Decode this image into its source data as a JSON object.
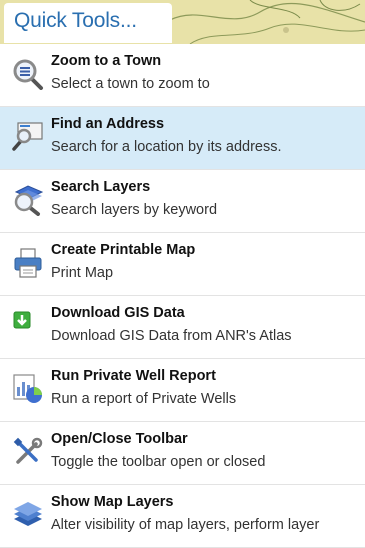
{
  "panel": {
    "title": "Quick Tools..."
  },
  "items": [
    {
      "name": "Zoom to a Town",
      "desc": "Select a town to zoom to",
      "icon": "magnifier-list-icon"
    },
    {
      "name": "Find an Address",
      "desc": "Search for a location by its address.",
      "icon": "find-address-icon"
    },
    {
      "name": "Search Layers",
      "desc": "Search layers by keyword",
      "icon": "search-layers-icon"
    },
    {
      "name": "Create Printable Map",
      "desc": "Print Map",
      "icon": "printer-icon"
    },
    {
      "name": "Download GIS Data",
      "desc": "Download GIS Data from ANR's Atlas",
      "icon": "download-icon"
    },
    {
      "name": "Run Private Well Report",
      "desc": "Run a report of Private Wells",
      "icon": "report-chart-icon"
    },
    {
      "name": "Open/Close Toolbar",
      "desc": "Toggle the toolbar open or closed",
      "icon": "tools-icon"
    },
    {
      "name": "Show Map Layers",
      "desc": "Alter visibility of map layers, perform layer",
      "icon": "layers-icon"
    }
  ],
  "colors": {
    "title": "#2a6fb0",
    "selected_row": "#d6ebf8",
    "map_background": "#e8e2a8"
  }
}
